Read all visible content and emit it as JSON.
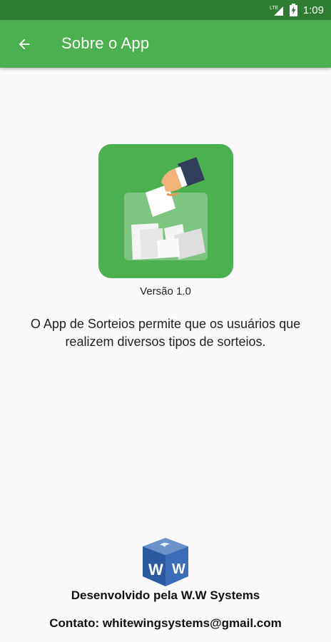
{
  "status_bar": {
    "network": "LTE",
    "time": "1:09"
  },
  "app_bar": {
    "title": "Sobre o App",
    "back_icon": "arrow-left-icon"
  },
  "content": {
    "version": "Versão 1.0",
    "description": "O App de Sorteios permite que os usuários que realizem diversos tipos de sorteios."
  },
  "footer": {
    "logo_text": "W W",
    "developer": "Desenvolvido pela W.W Systems",
    "contact": "Contato: whitewingsystems@gmail.com"
  },
  "colors": {
    "status_bar": "#2e7d32",
    "app_bar": "#4caf50",
    "logo_background": "#4caf50",
    "background": "#fafafa"
  }
}
